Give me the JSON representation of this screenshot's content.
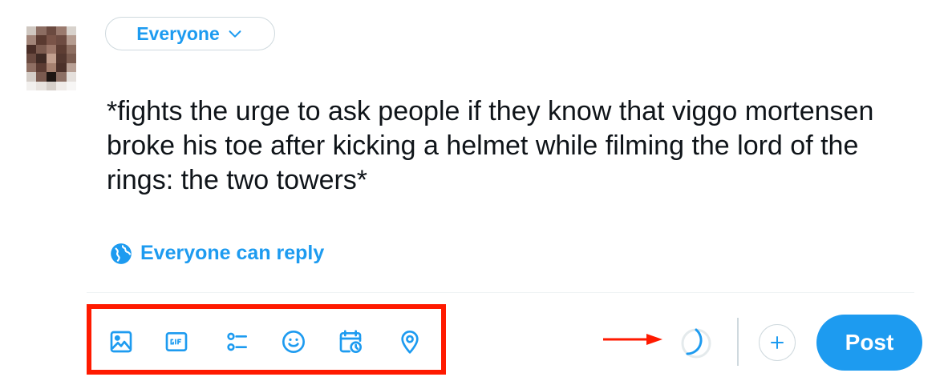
{
  "composer": {
    "audience_label": "Everyone",
    "tweet_text": "*fights the urge to ask people if they know that viggo mortensen broke his toe after kicking a helmet while filming the lord of the rings: the two towers*",
    "reply_setting_label": "Everyone can reply"
  },
  "toolbar": {
    "icons": [
      "image-icon",
      "gif-icon",
      "poll-icon",
      "emoji-icon",
      "schedule-icon",
      "location-icon"
    ],
    "post_label": "Post"
  },
  "colors": {
    "accent": "#1d9bf0",
    "highlight": "#ff1a00",
    "border": "#cfd9de",
    "text": "#0f1419"
  }
}
